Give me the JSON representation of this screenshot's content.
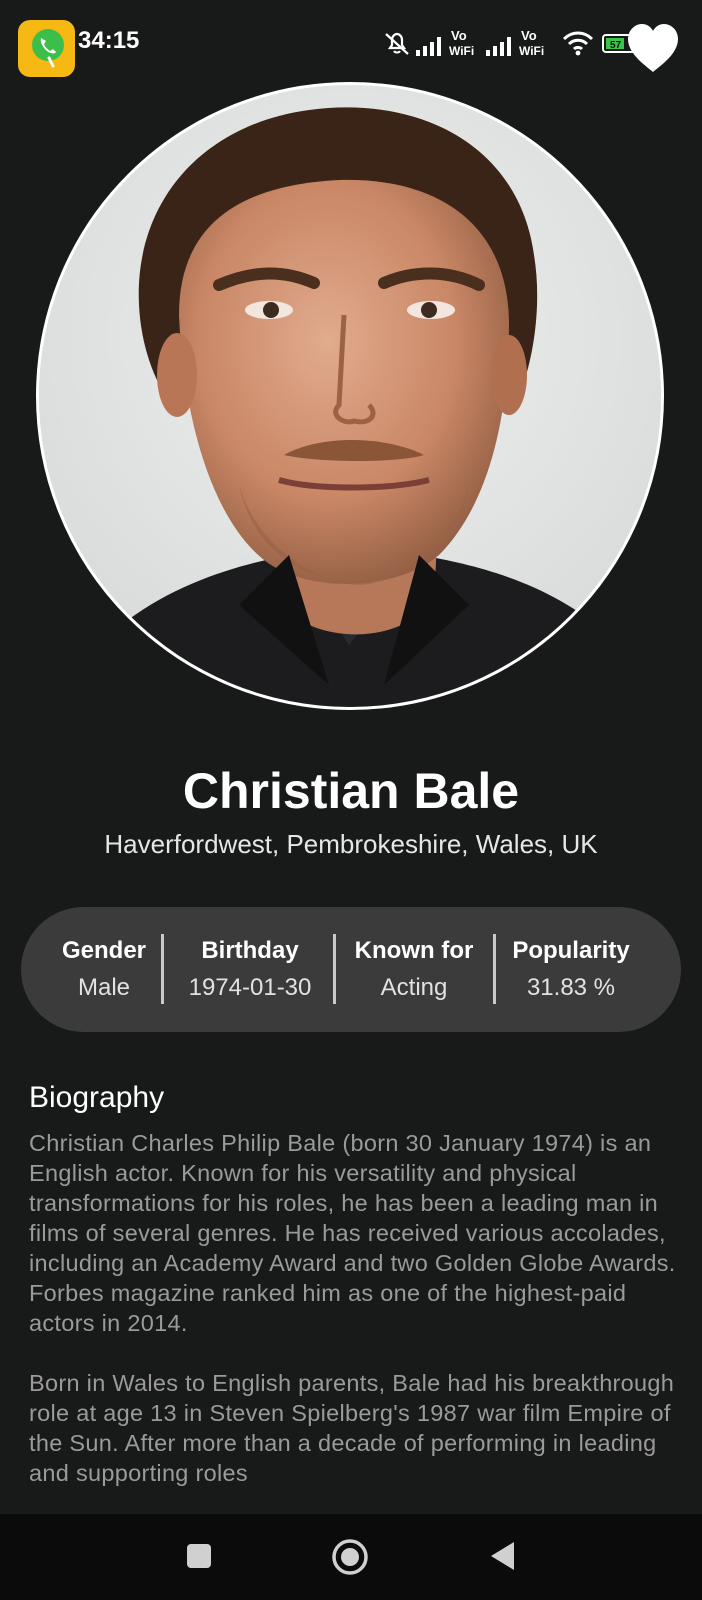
{
  "status_bar": {
    "time": "34:15",
    "battery_level": "57",
    "network_label": "Vo WiFi"
  },
  "profile": {
    "name": "Christian Bale",
    "place_of_birth": "Haverfordwest, Pembrokeshire, Wales, UK"
  },
  "stats": [
    {
      "label": "Gender",
      "value": "Male"
    },
    {
      "label": "Birthday",
      "value": "1974-01-30"
    },
    {
      "label": "Known for",
      "value": "Acting"
    },
    {
      "label": "Popularity",
      "value": "31.83 %"
    }
  ],
  "biography": {
    "heading": "Biography",
    "paragraphs": [
      "Christian Charles Philip Bale (born 30 January 1974) is an English actor. Known for his versatility and physical transformations for his roles, he has been a leading man in films of several genres. He has received various accolades, including an Academy Award and two Golden Globe Awards. Forbes magazine ranked him as one of the highest-paid actors in 2014.",
      "Born in Wales to English parents, Bale had his breakthrough role at age 13 in Steven Spielberg's 1987 war film Empire of the Sun. After more than a decade of performing in leading and supporting roles"
    ]
  },
  "icons": {
    "call_app": "phone-icon",
    "favorite": "heart-icon",
    "nav_recents": "square-icon",
    "nav_home": "circle-icon",
    "nav_back": "triangle-back-icon"
  },
  "colors": {
    "background": "#181a19",
    "card": "#3a3b3a",
    "accent_call_app": "#f6b812",
    "biography_text": "#9a9a9a"
  }
}
